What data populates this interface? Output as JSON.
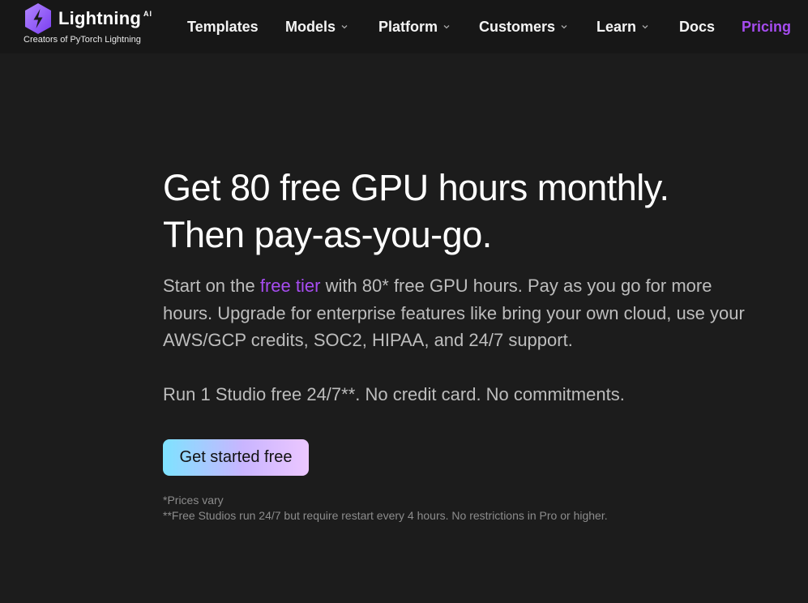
{
  "brand": {
    "name": "Lightning",
    "suffix": "AI",
    "tagline": "Creators of PyTorch Lightning",
    "logo_icon": "lightning-bolt-icon",
    "accent_color": "#a64cf0"
  },
  "nav": {
    "items": [
      {
        "label": "Templates",
        "has_dropdown": false
      },
      {
        "label": "Models",
        "has_dropdown": true
      },
      {
        "label": "Platform",
        "has_dropdown": true
      },
      {
        "label": "Customers",
        "has_dropdown": true
      },
      {
        "label": "Learn",
        "has_dropdown": true
      },
      {
        "label": "Docs",
        "has_dropdown": false
      },
      {
        "label": "Pricing",
        "has_dropdown": false,
        "active": true
      }
    ]
  },
  "hero": {
    "title_line1": "Get 80 free GPU hours monthly.",
    "title_line2": "Then pay-as-you-go.",
    "desc_before_link": "Start on the ",
    "desc_link": "free tier",
    "desc_after_link": " with 80* free GPU hours. Pay as you go for more hours. Upgrade for enterprise features like bring your own cloud, use your AWS/GCP credits, SOC2, HIPAA, and 24/7 support.",
    "note": "Run 1 Studio free 24/7**. No credit card. No commitments.",
    "cta_label": "Get started free"
  },
  "footnotes": {
    "line1": "*Prices vary",
    "line2": "**Free Studios run 24/7 but require restart every 4 hours. No restrictions in Pro or higher."
  }
}
